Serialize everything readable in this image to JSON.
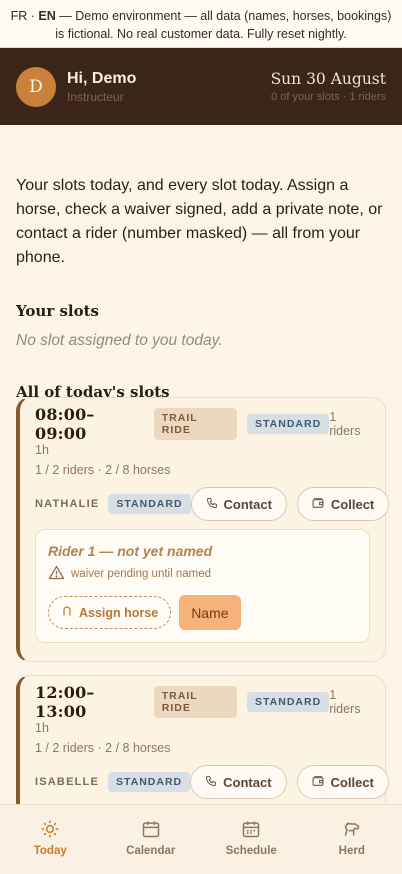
{
  "banner": {
    "lang_fr": "FR",
    "lang_sep": "·",
    "lang_en": "EN",
    "text": "— Demo environment — all data (names, horses, bookings) is fictional. No real customer data. Fully reset nightly."
  },
  "header": {
    "avatar_initial": "D",
    "greeting": "Hi, Demo",
    "role": "Instructeur",
    "date": "Sun 30 August",
    "slots_summary": "0 of your slots · 1 riders"
  },
  "intro": "Your slots today, and every slot today. Assign a horse, check a waiver signed, add a private note, or contact a rider (number masked) — all from your phone.",
  "your_slots": {
    "title": "Your slots",
    "empty_text": "No slot assigned to you today."
  },
  "all_slots": {
    "title": "All of today's slots",
    "slots": [
      {
        "time": "08:00–09:00",
        "kind": "TRAIL RIDE",
        "level": "STANDARD",
        "riders_count": "1 riders",
        "duration": "1h",
        "capacity": "1 / 2 riders · 2 / 8 horses",
        "instructor": "NATHALIE",
        "instructor_level": "STANDARD",
        "contact_label": "Contact",
        "collect_label": "Collect",
        "rider": {
          "title": "Rider 1 — not yet named",
          "waiver": "waiver pending until named",
          "assign_label": "Assign horse",
          "name_label": "Name"
        }
      },
      {
        "time": "12:00–13:00",
        "kind": "TRAIL RIDE",
        "level": "STANDARD",
        "riders_count": "1 riders",
        "duration": "1h",
        "capacity": "1 / 2 riders · 2 / 8 horses",
        "instructor": "ISABELLE",
        "instructor_level": "STANDARD",
        "contact_label": "Contact",
        "collect_label": "Collect"
      }
    ]
  },
  "nav": [
    {
      "label": "Today",
      "icon": "sun-icon",
      "active": true
    },
    {
      "label": "Calendar",
      "icon": "calendar-icon",
      "active": false
    },
    {
      "label": "Schedule",
      "icon": "schedule-icon",
      "active": false
    },
    {
      "label": "Herd",
      "icon": "horse-icon",
      "active": false
    }
  ],
  "colors": {
    "header_bg": "#3b2518",
    "accent": "#c77a32",
    "card_border": "#8a5a2e",
    "name_button": "#f7b17a"
  }
}
